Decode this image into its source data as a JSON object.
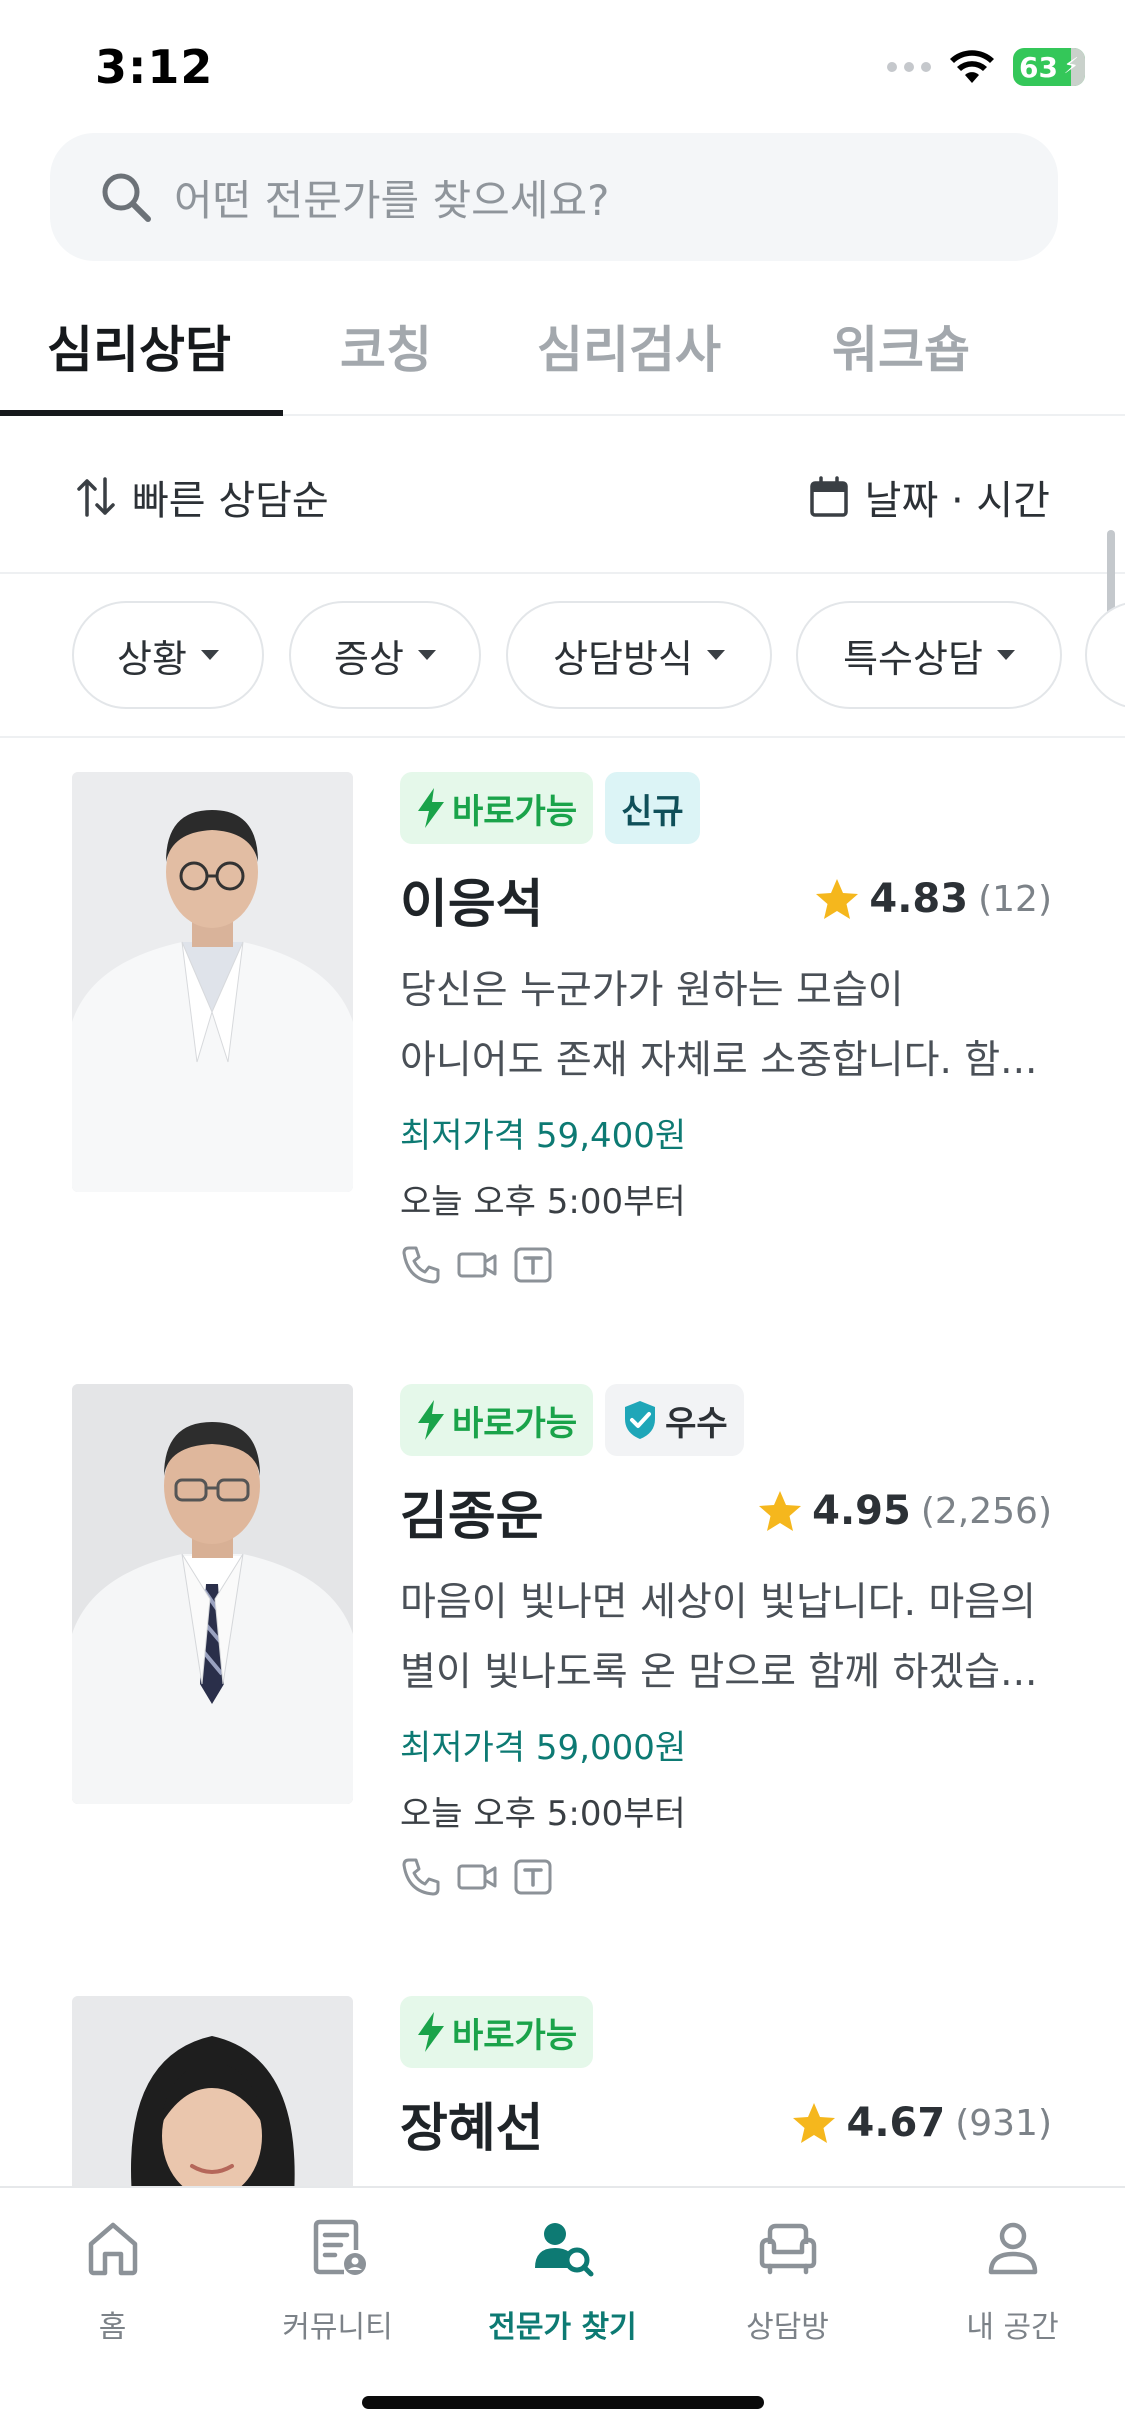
{
  "status_bar": {
    "time": "3:12",
    "battery": "63"
  },
  "search": {
    "placeholder": "어떤 전문가를 찾으세요?"
  },
  "tabs": [
    {
      "label": "심리상담",
      "active": true
    },
    {
      "label": "코칭",
      "active": false
    },
    {
      "label": "심리검사",
      "active": false
    },
    {
      "label": "워크숍",
      "active": false
    }
  ],
  "sort": {
    "order_label": "빠른 상담순",
    "date_label": "날짜 · 시간"
  },
  "filters": [
    {
      "label": "상황"
    },
    {
      "label": "증상"
    },
    {
      "label": "상담방식"
    },
    {
      "label": "특수상담"
    }
  ],
  "counselors": [
    {
      "badges": [
        "바로가능",
        "신규"
      ],
      "name": "이응석",
      "rating": "4.83",
      "review_count": "(12)",
      "desc_line1": "당신은 누군가가 원하는 모습이",
      "desc_line2": "아니어도 존재 자체로 소중합니다. 함...",
      "price": "최저가격 59,400원",
      "availability": "오늘 오후 5:00부터"
    },
    {
      "badges": [
        "바로가능",
        "우수"
      ],
      "name": "김종운",
      "rating": "4.95",
      "review_count": "(2,256)",
      "desc_line1": "마음이 빛나면 세상이 빛납니다. 마음의",
      "desc_line2": "별이 빛나도록 온 맘으로 함께 하겠습...",
      "price": "최저가격 59,000원",
      "availability": "오늘 오후 5:00부터"
    },
    {
      "badges": [
        "바로가능"
      ],
      "name": "장혜선",
      "rating": "4.67",
      "review_count": "(931)"
    }
  ],
  "bottom_nav": [
    {
      "label": "홈",
      "icon": "home-icon"
    },
    {
      "label": "커뮤니티",
      "icon": "community-icon"
    },
    {
      "label": "전문가 찾기",
      "icon": "find-expert-icon",
      "active": true
    },
    {
      "label": "상담방",
      "icon": "sofa-icon"
    },
    {
      "label": "내 공간",
      "icon": "person-icon"
    }
  ],
  "colors": {
    "accent": "#0d7a73",
    "now_green": "#1aa34a",
    "star": "#f5b71d"
  }
}
